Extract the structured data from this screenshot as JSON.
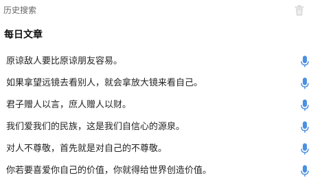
{
  "history": {
    "title": "历史搜索",
    "delete_icon": "trash-icon"
  },
  "daily": {
    "title": "每日文章",
    "items": [
      {
        "text": "原谅敌人要比原谅朋友容易。",
        "icon": "microphone-icon"
      },
      {
        "text": "如果拿望远镜去看别人，就会拿放大镜来看自己。",
        "icon": "microphone-icon"
      },
      {
        "text": "君子赠人以言，庶人赠人以财。",
        "icon": "microphone-icon"
      },
      {
        "text": "我们爱我们的民族，这是我们自信心的源泉。",
        "icon": "microphone-icon"
      },
      {
        "text": "对人不尊敬，首先就是对自己的不尊敬。",
        "icon": "microphone-icon"
      },
      {
        "text": "你若要喜爱你自己的价值，你就得给世界创造价值。",
        "icon": "microphone-icon"
      }
    ]
  },
  "colors": {
    "mic": "#4a90e2",
    "trash": "#d9d9d9"
  }
}
